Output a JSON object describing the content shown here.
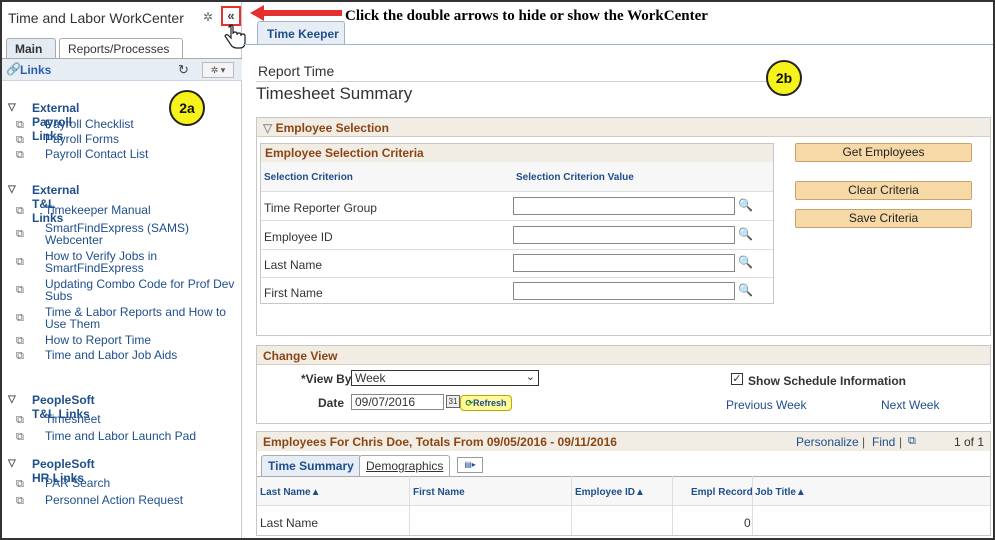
{
  "workcenter": {
    "title": "Time and Labor WorkCenter",
    "collapse_glyph": "«",
    "tabs": [
      "Main",
      "Reports/Processes"
    ],
    "links_title": "Links",
    "badge": "2a",
    "groups": [
      {
        "title": "External Payroll Links",
        "items": [
          "Payroll Checklist",
          "Payroll Forms",
          "Payroll Contact List"
        ]
      },
      {
        "title": "External T&L Links",
        "items": [
          "Timekeeper Manual",
          "SmartFindExpress (SAMS) Webcenter",
          "How to Verify Jobs in SmartFindExpress",
          "Updating Combo Code for Prof Dev Subs",
          "Time & Labor Reports and How to Use Them",
          "How to Report Time",
          "Time and Labor Job Aids"
        ]
      },
      {
        "title": "PeopleSoft T&L Links",
        "items": [
          "Timesheet",
          "Time and Labor Launch Pad"
        ]
      },
      {
        "title": "PeopleSoft HR Links",
        "items": [
          "PAR Search",
          "Personnel Action Request"
        ]
      }
    ]
  },
  "annotation": {
    "note": "Click the double arrows to hide or show the WorkCenter",
    "badge": "2b"
  },
  "main": {
    "tab": "Time Keeper",
    "report_time": "Report Time",
    "page_title": "Timesheet Summary",
    "employee_selection": {
      "title": "Employee Selection",
      "criteria_title": "Employee Selection Criteria",
      "col_criterion": "Selection Criterion",
      "col_value": "Selection Criterion Value",
      "rows": [
        "Time Reporter Group",
        "Employee ID",
        "Last Name",
        "First Name"
      ],
      "buttons": [
        "Get Employees",
        "Clear Criteria",
        "Save Criteria"
      ]
    },
    "change_view": {
      "title": "Change View",
      "view_by_label": "*View By",
      "view_by_value": "Week",
      "date_label": "Date",
      "date_value": "09/07/2016",
      "refresh": "Refresh",
      "show_schedule": "Show Schedule Information",
      "prev_week": "Previous Week",
      "next_week": "Next Week"
    },
    "grid": {
      "title": "Employees For Chris Doe, Totals From 09/05/2016 - 09/11/2016",
      "personalize": "Personalize",
      "find": "Find",
      "pager": "1 of 1",
      "tabs": [
        "Time Summary",
        "Demographics"
      ],
      "columns": [
        "Last Name▲",
        "First Name",
        "Employee ID▲",
        "Empl Record",
        "Job Title▲"
      ],
      "row": {
        "last_name": "Last Name",
        "first_name": "",
        "employee_id": "",
        "empl_record": "0",
        "job_title": ""
      }
    }
  }
}
